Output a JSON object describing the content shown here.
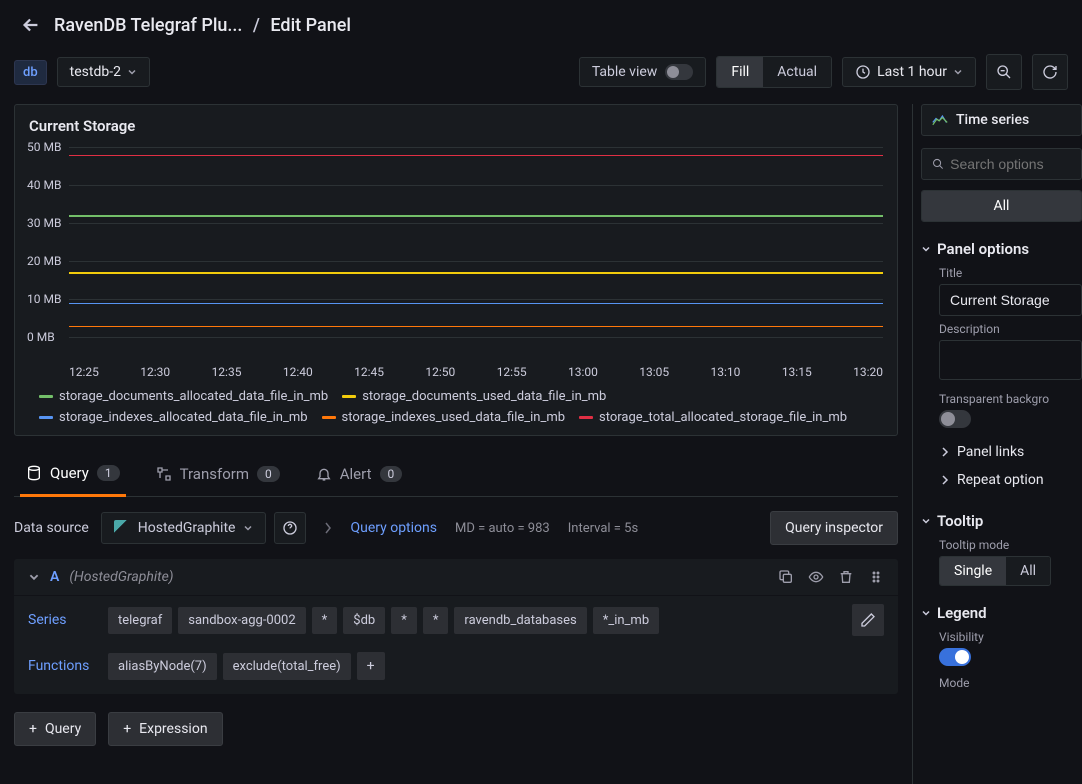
{
  "header": {
    "dashboard": "RavenDB Telegraf Plu...",
    "page": "Edit Panel"
  },
  "toolbar": {
    "var_badge": "db",
    "var_value": "testdb-2",
    "table_view": "Table view",
    "fill": "Fill",
    "actual": "Actual",
    "time_range": "Last 1 hour"
  },
  "viz_picker": "Time series",
  "search_placeholder": "Search options",
  "filter_all": "All",
  "panel": {
    "title": "Current Storage"
  },
  "chart_data": {
    "type": "line",
    "title": "Current Storage",
    "ylabel": "",
    "ylim": [
      0,
      50
    ],
    "yticks": [
      "0 MB",
      "10 MB",
      "20 MB",
      "30 MB",
      "40 MB",
      "50 MB"
    ],
    "xticks": [
      "12:25",
      "12:30",
      "12:35",
      "12:40",
      "12:45",
      "12:50",
      "12:55",
      "13:00",
      "13:05",
      "13:10",
      "13:15",
      "13:20"
    ],
    "series": [
      {
        "name": "storage_documents_allocated_data_file_in_mb",
        "color": "#73bf69",
        "value": 32
      },
      {
        "name": "storage_documents_used_data_file_in_mb",
        "color": "#f2cc0c",
        "value": 17
      },
      {
        "name": "storage_indexes_allocated_data_file_in_mb",
        "color": "#5794f2",
        "value": 9
      },
      {
        "name": "storage_indexes_used_data_file_in_mb",
        "color": "#ff780a",
        "value": 3
      },
      {
        "name": "storage_total_allocated_storage_file_in_mb",
        "color": "#e02f44",
        "value": 48
      }
    ]
  },
  "tabs": {
    "query": "Query",
    "query_count": "1",
    "transform": "Transform",
    "transform_count": "0",
    "alert": "Alert",
    "alert_count": "0"
  },
  "ds": {
    "label": "Data source",
    "name": "HostedGraphite",
    "query_options": "Query options",
    "md": "MD = auto = 983",
    "interval": "Interval = 5s",
    "inspector": "Query inspector"
  },
  "query": {
    "letter": "A",
    "ds_hint": "(HostedGraphite)",
    "series_label": "Series",
    "series_segs": [
      "telegraf",
      "sandbox-agg-0002",
      "*",
      "$db",
      "*",
      "*",
      "ravendb_databases",
      "*_in_mb"
    ],
    "functions_label": "Functions",
    "functions_segs": [
      "aliasByNode(7)",
      "exclude(total_free)"
    ]
  },
  "bottom": {
    "query": "Query",
    "expression": "Expression"
  },
  "sidebar": {
    "panel_options": "Panel options",
    "title_label": "Title",
    "title_value": "Current Storage",
    "description_label": "Description",
    "transparent": "Transparent backgro",
    "panel_links": "Panel links",
    "repeat": "Repeat option",
    "tooltip": "Tooltip",
    "tooltip_mode": "Tooltip mode",
    "single": "Single",
    "all": "All",
    "legend": "Legend",
    "visibility": "Visibility",
    "mode": "Mode"
  }
}
